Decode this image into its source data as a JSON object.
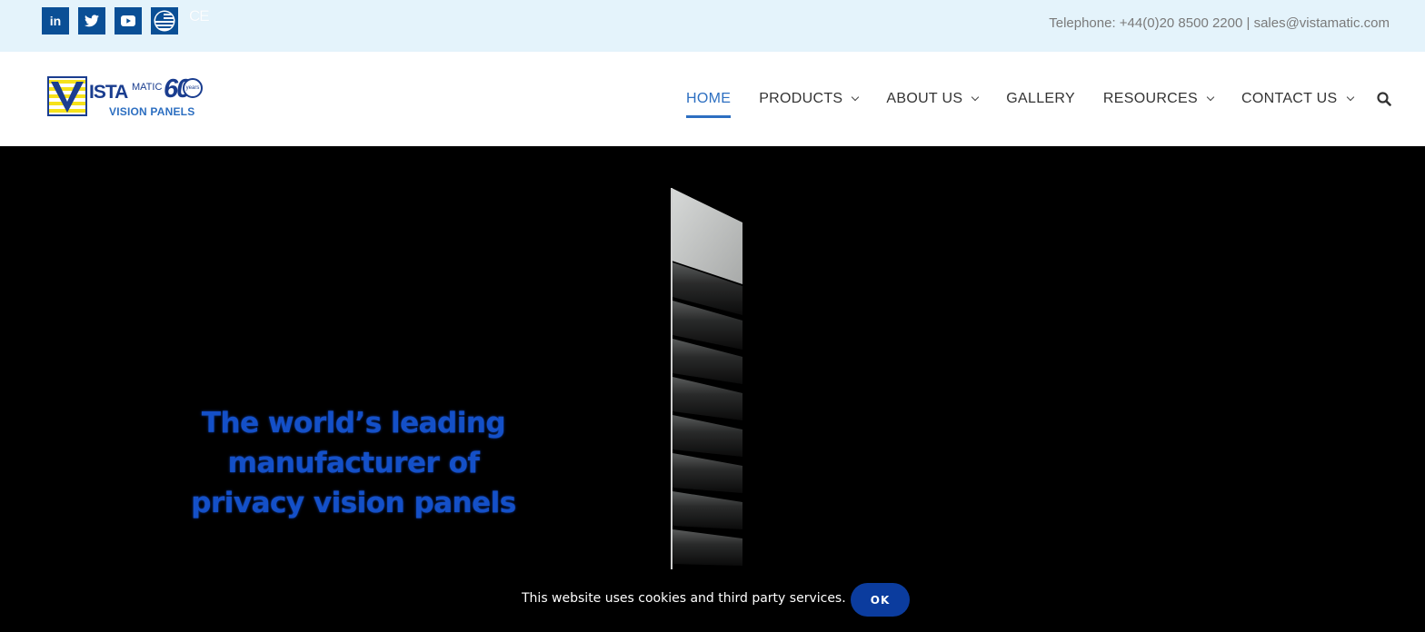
{
  "topbar": {
    "social_icons": [
      "linkedin-icon",
      "twitter-icon",
      "youtube-icon",
      "usa-flag-icon"
    ],
    "linkedin_label": "in",
    "ce_mark": "CE",
    "contact_text": "Telephone: +44(0)20 8500 2200 | sales@vistamatic.com"
  },
  "header": {
    "logo": {
      "brand": "ISTA",
      "brand_suffix": "MATIC",
      "anniversary": "60",
      "anniversary_sub": "years",
      "subtitle": "VISION PANELS"
    },
    "nav": [
      {
        "label": "HOME",
        "active": true,
        "dropdown": false
      },
      {
        "label": "PRODUCTS",
        "active": false,
        "dropdown": true
      },
      {
        "label": "ABOUT US",
        "active": false,
        "dropdown": true
      },
      {
        "label": "GALLERY",
        "active": false,
        "dropdown": false
      },
      {
        "label": "RESOURCES",
        "active": false,
        "dropdown": true
      },
      {
        "label": "CONTACT US",
        "active": false,
        "dropdown": true
      }
    ],
    "search_icon": "search-icon"
  },
  "hero": {
    "tagline_line1": "The world’s leading",
    "tagline_line2": "manufacturer of",
    "tagline_line3": "privacy vision panels",
    "tagline_color": "#1450c8"
  },
  "cookie": {
    "text": "This website uses cookies and third party services.",
    "button_label": "OK",
    "button_color": "#0b3c9e"
  },
  "colors": {
    "topbar_bg": "#e4f3fb",
    "accent": "#2d6fc1",
    "social_bg": "#0a4f96"
  }
}
